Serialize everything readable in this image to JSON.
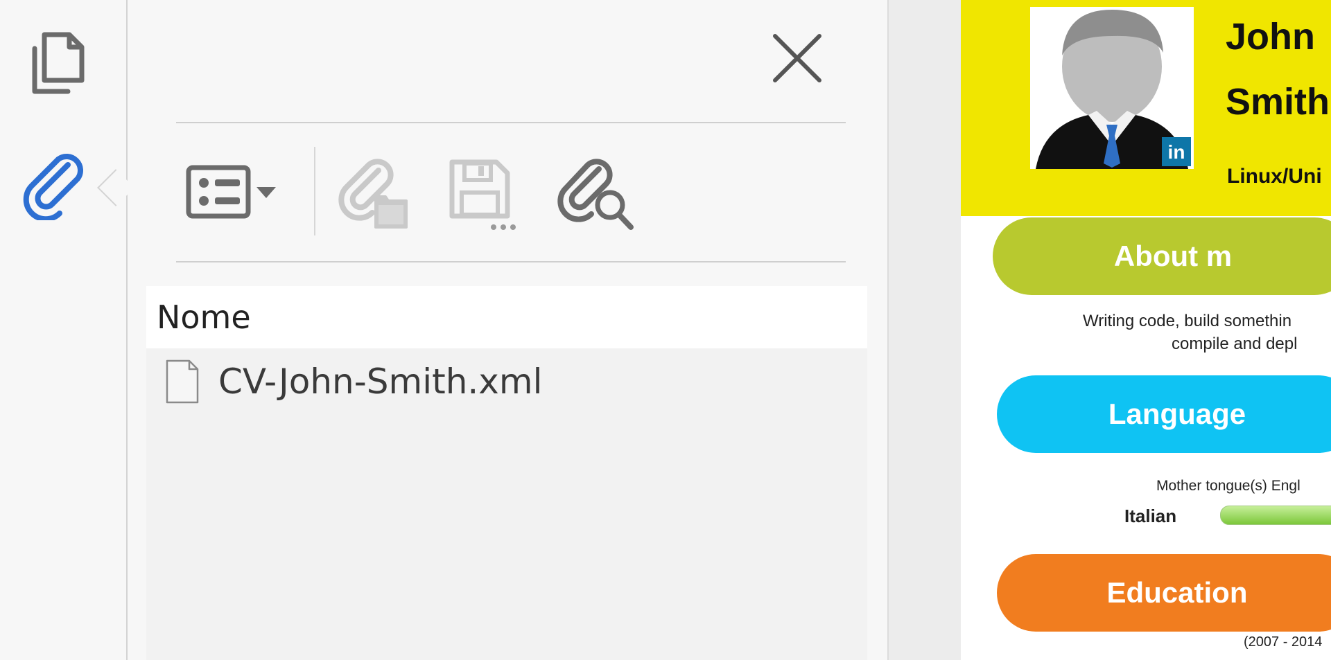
{
  "left_rail": {
    "pages_icon": "pages-thumbnail-icon",
    "attachments_icon": "paperclip-icon",
    "attachments_active_color": "#2d6fd2"
  },
  "attachments_panel": {
    "close_icon": "close-icon",
    "toolbar": {
      "options_icon": "list-options-dropdown-icon",
      "open_icon": "open-attachment-icon",
      "save_icon": "save-attachment-icon",
      "search_icon": "search-attachments-icon"
    },
    "column_header": "Nome",
    "files": [
      {
        "name": "CV-John-Smith.xml",
        "icon": "xml-file-icon"
      }
    ]
  },
  "document": {
    "first_name": "John",
    "last_name": "Smith",
    "role": "Linux/Uni",
    "linkedin_badge": "in",
    "sections": {
      "about": {
        "title": "About m",
        "color": "#b8c92f"
      },
      "languages": {
        "title": "Language",
        "color": "#0fc3f3"
      },
      "education": {
        "title": "Education",
        "color": "#f17d1f"
      }
    },
    "about_line1": "Writing code, build somethin",
    "about_line2": "compile and depl",
    "mother_tongue": "Mother tongue(s) Engl",
    "language_name": "Italian",
    "education_dates": "(2007 - 2014"
  }
}
